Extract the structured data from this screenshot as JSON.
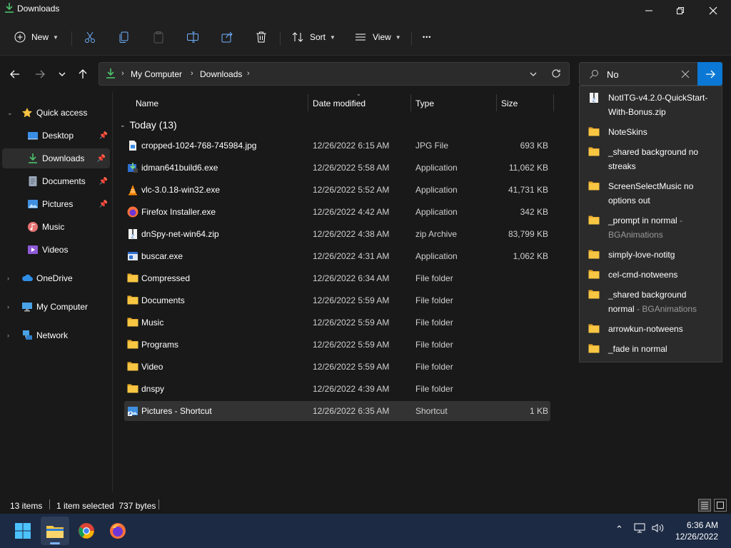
{
  "window": {
    "title": "Downloads"
  },
  "toolbar": {
    "new_label": "New",
    "sort_label": "Sort",
    "view_label": "View",
    "more_label": "•••"
  },
  "address": {
    "crumbs": [
      "My Computer",
      "Downloads"
    ]
  },
  "search": {
    "value": "No",
    "placeholder": ""
  },
  "sidebar": {
    "items": [
      {
        "label": "Quick access"
      },
      {
        "label": "Desktop"
      },
      {
        "label": "Downloads"
      },
      {
        "label": "Documents"
      },
      {
        "label": "Pictures"
      },
      {
        "label": "Music"
      },
      {
        "label": "Videos"
      },
      {
        "label": "OneDrive"
      },
      {
        "label": "My Computer"
      },
      {
        "label": "Network"
      }
    ]
  },
  "columns": {
    "name": "Name",
    "date": "Date modified",
    "type": "Type",
    "size": "Size"
  },
  "group": {
    "label": "Today (13)"
  },
  "files": [
    {
      "name": "cropped-1024-768-745984.jpg",
      "date": "12/26/2022 6:15 AM",
      "type": "JPG File",
      "size": "693 KB",
      "icon": "image-file-icon"
    },
    {
      "name": "idman641build6.exe",
      "date": "12/26/2022 5:58 AM",
      "type": "Application",
      "size": "11,062 KB",
      "icon": "installer-icon"
    },
    {
      "name": "vlc-3.0.18-win32.exe",
      "date": "12/26/2022 5:52 AM",
      "type": "Application",
      "size": "41,731 KB",
      "icon": "vlc-cone-icon"
    },
    {
      "name": "Firefox Installer.exe",
      "date": "12/26/2022 4:42 AM",
      "type": "Application",
      "size": "342 KB",
      "icon": "firefox-icon"
    },
    {
      "name": "dnSpy-net-win64.zip",
      "date": "12/26/2022 4:38 AM",
      "type": "zip Archive",
      "size": "83,799 KB",
      "icon": "zip-archive-icon"
    },
    {
      "name": "buscar.exe",
      "date": "12/26/2022 4:31 AM",
      "type": "Application",
      "size": "1,062 KB",
      "icon": "application-icon"
    },
    {
      "name": "Compressed",
      "date": "12/26/2022 6:34 AM",
      "type": "File folder",
      "size": "",
      "icon": "folder-icon"
    },
    {
      "name": "Documents",
      "date": "12/26/2022 5:59 AM",
      "type": "File folder",
      "size": "",
      "icon": "folder-icon"
    },
    {
      "name": "Music",
      "date": "12/26/2022 5:59 AM",
      "type": "File folder",
      "size": "",
      "icon": "folder-icon"
    },
    {
      "name": "Programs",
      "date": "12/26/2022 5:59 AM",
      "type": "File folder",
      "size": "",
      "icon": "folder-icon"
    },
    {
      "name": "Video",
      "date": "12/26/2022 5:59 AM",
      "type": "File folder",
      "size": "",
      "icon": "folder-icon"
    },
    {
      "name": "dnspy",
      "date": "12/26/2022 4:39 AM",
      "type": "File folder",
      "size": "",
      "icon": "folder-icon"
    },
    {
      "name": "Pictures - Shortcut",
      "date": "12/26/2022 6:35 AM",
      "type": "Shortcut",
      "size": "1 KB",
      "icon": "shortcut-icon"
    }
  ],
  "suggestions": [
    {
      "line1": "NotITG-v4.2.0-QuickStart-",
      "line2": "With-Bonus.zip",
      "loc": "",
      "icon": "zip-archive-icon"
    },
    {
      "line1": "NoteSkins",
      "line2": "",
      "loc": "",
      "icon": "folder-icon"
    },
    {
      "line1": "_shared background no",
      "line2": "streaks",
      "loc": "",
      "icon": "folder-icon"
    },
    {
      "line1": "ScreenSelectMusic no",
      "line2": "options out",
      "loc": "",
      "icon": "folder-icon"
    },
    {
      "line1": "_prompt in normal",
      "line2": "",
      "loc": " - BGAnimations",
      "icon": "folder-icon"
    },
    {
      "line1": "simply-love-notitg",
      "line2": "",
      "loc": "",
      "icon": "folder-icon"
    },
    {
      "line1": "cel-cmd-notweens",
      "line2": "",
      "loc": "",
      "icon": "folder-icon"
    },
    {
      "line1": "_shared background",
      "line2": "normal",
      "loc": " - BGAnimations",
      "icon": "folder-icon"
    },
    {
      "line1": "arrowkun-notweens",
      "line2": "",
      "loc": "",
      "icon": "folder-icon"
    },
    {
      "line1": "_fade in normal",
      "line2": "",
      "loc": "",
      "icon": "folder-icon"
    }
  ],
  "status": {
    "items": "13 items",
    "selection": "1 item selected  737 bytes"
  },
  "taskbar": {
    "time": "6:36 AM",
    "date": "12/26/2022"
  },
  "colors": {
    "accent": "#0a78d4",
    "folder": "#f8c642",
    "taskbar": "#1c2a44"
  }
}
